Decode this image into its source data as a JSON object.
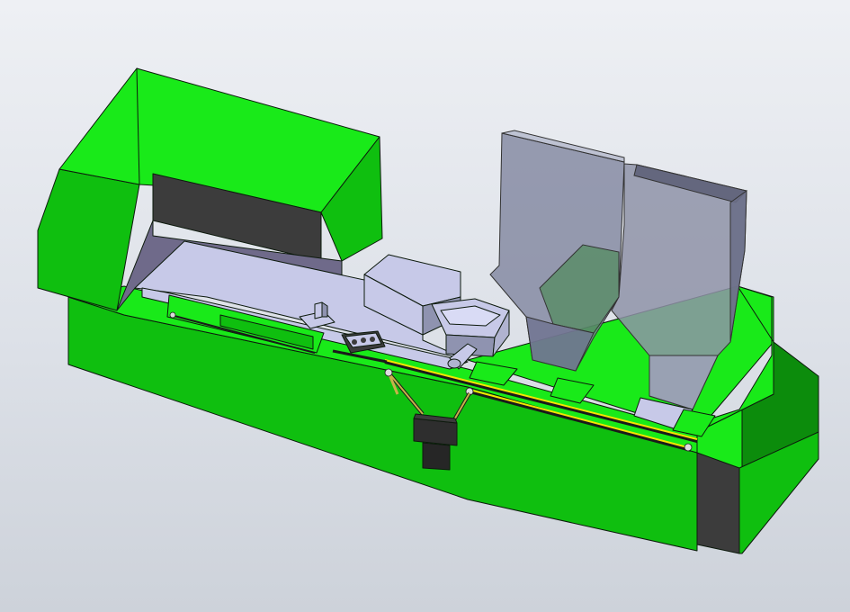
{
  "viewport": {
    "background_top": "#eef0f4",
    "background_bottom": "#cdd2da"
  },
  "model": {
    "palette": {
      "green_bright": "#19ea19",
      "green_mid": "#0fbf0f",
      "green_dark": "#0c8c0c",
      "dark_grey": "#3c3c3c",
      "lavender": "#c7c9e8",
      "purple_grey": "#6f6a8a",
      "hopper_glass": "#8f93a8",
      "yellow_rail": "#f2e600"
    },
    "components": [
      "machine-bed",
      "headstock-housing",
      "tailstock-block",
      "linear-guide-rail",
      "lead-screw",
      "carriage",
      "motor",
      "hopper-left",
      "hopper-right",
      "feed-tray",
      "clamp-fixture"
    ]
  }
}
